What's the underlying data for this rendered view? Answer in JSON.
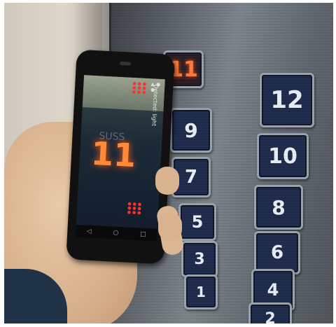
{
  "elevator_panel": {
    "buttons": [
      {
        "label": "11",
        "lit": true
      },
      {
        "label": "12",
        "lit": false
      },
      {
        "label": "9",
        "lit": false
      },
      {
        "label": "10",
        "lit": false
      },
      {
        "label": "7",
        "lit": false
      },
      {
        "label": "8",
        "lit": false
      },
      {
        "label": "5",
        "lit": false
      },
      {
        "label": "6",
        "lit": false
      },
      {
        "label": "3",
        "lit": false
      },
      {
        "label": "4",
        "lit": false
      },
      {
        "label": "1",
        "lit": false
      },
      {
        "label": "2",
        "lit": false
      }
    ]
  },
  "phone": {
    "screen_number": "11",
    "ghost_text": "SUSS",
    "ar_label": "Detected: light",
    "nav": [
      "◁",
      "○",
      "□"
    ]
  },
  "colors": {
    "button_face": "#1d2a4a",
    "lit_digit": "#ff7a3a",
    "panel_steel": "#6c737a"
  }
}
